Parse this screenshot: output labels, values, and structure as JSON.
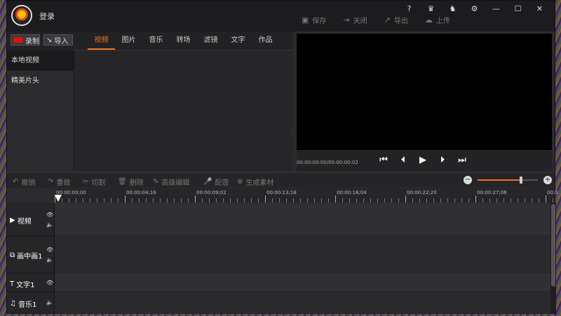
{
  "titlebar": {
    "login": "登录",
    "top_icons": [
      "?",
      "♛",
      "♞",
      "⚙",
      "—",
      "☐",
      "✕"
    ]
  },
  "toolbar": {
    "save": "保存",
    "close": "关闭",
    "export": "导出",
    "upload": "上传"
  },
  "left": {
    "record": "录制",
    "import": "导入",
    "tabs": [
      "视频",
      "图片",
      "音乐",
      "转场",
      "滤镜",
      "文字",
      "作品"
    ],
    "active_tab": "视频",
    "sidebar": [
      "本地视频",
      "精美片头"
    ]
  },
  "player": {
    "timecode": "00:00:00:00/00:00:00:02"
  },
  "edit_toolbar": {
    "undo": "撤销",
    "redo": "重做",
    "cut": "切割",
    "delete": "删除",
    "advanced": "高级编辑",
    "dub": "配音",
    "generate": "生成素材"
  },
  "zoom": {
    "level": 0.72
  },
  "ruler": [
    "00:00:00;00",
    "00:00:04;16",
    "00:00:09;02",
    "00:00:13;18",
    "00:00:18;04",
    "00:00:22;20",
    "00:00:27;06",
    "00:0"
  ],
  "tracks": {
    "video": "视频",
    "pip": "画中画1",
    "text": "文字1",
    "music": "音乐1"
  },
  "colors": {
    "accent": "#f07020",
    "record": "#e01010"
  }
}
